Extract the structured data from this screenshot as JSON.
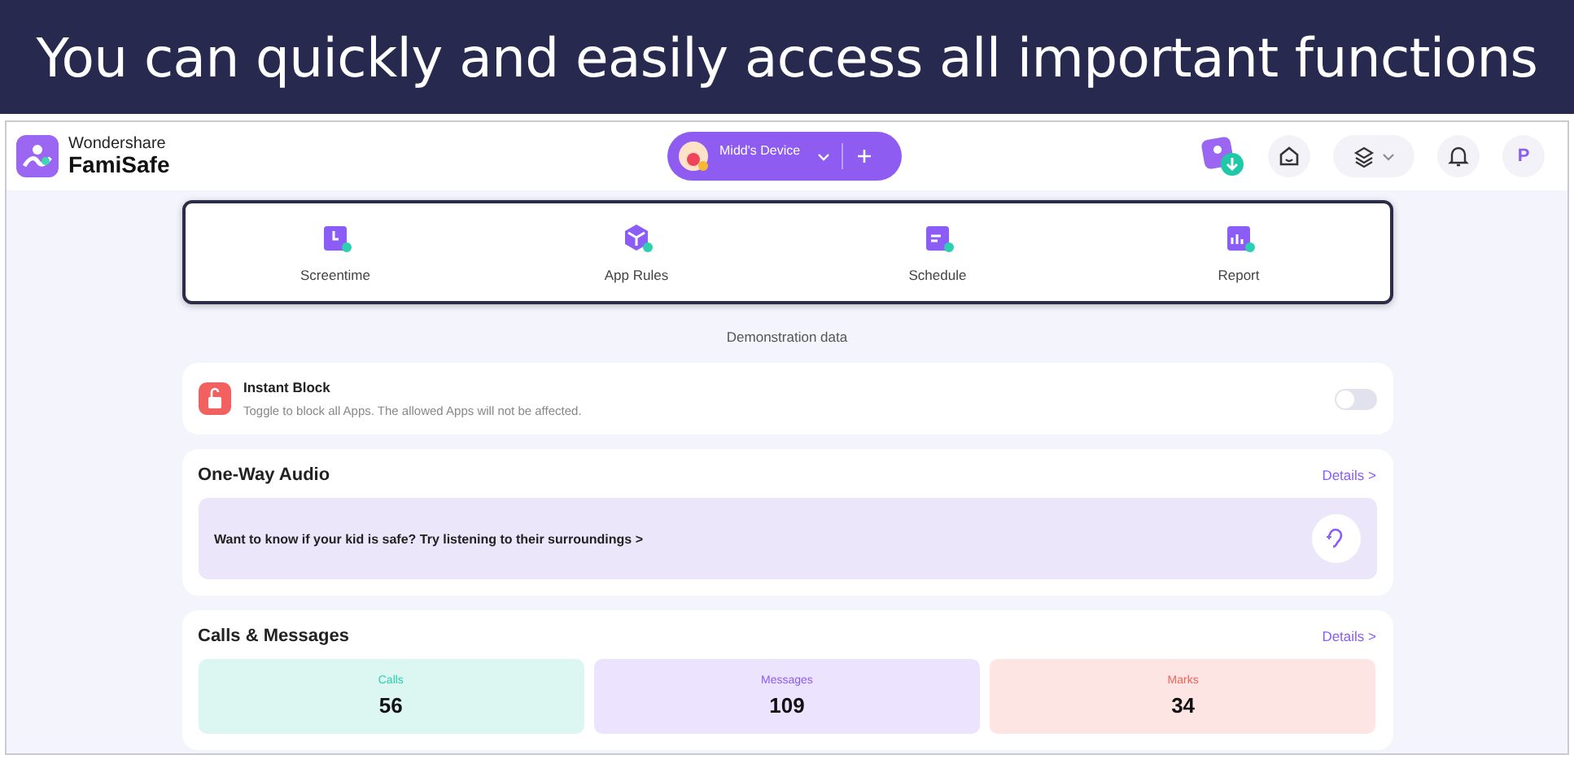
{
  "banner": {
    "text": "You can quickly and easily access all important functions"
  },
  "header": {
    "brand_top": "Wondershare",
    "brand_name": "FamiSafe",
    "device": {
      "name": "Midd's Device"
    },
    "avatar_letter": "P"
  },
  "features": [
    {
      "label": "Screentime",
      "kind": "clock"
    },
    {
      "label": "App Rules",
      "kind": "cube"
    },
    {
      "label": "Schedule",
      "kind": "calendar"
    },
    {
      "label": "Report",
      "kind": "chart"
    }
  ],
  "demo_note": "Demonstration data",
  "instant_block": {
    "title": "Instant Block",
    "description": "Toggle to block all Apps. The allowed Apps will not be affected.",
    "on": false
  },
  "one_way_audio": {
    "title": "One-Way Audio",
    "details": "Details >",
    "prompt": "Want to know if your kid is safe? Try listening to their surroundings >"
  },
  "calls_messages": {
    "title": "Calls & Messages",
    "details": "Details >",
    "stats": [
      {
        "label": "Calls",
        "value": "56",
        "color": "#2ccfb0"
      },
      {
        "label": "Messages",
        "value": "109",
        "color": "#8b5cf6"
      },
      {
        "label": "Marks",
        "value": "34",
        "color": "#f0645a"
      }
    ]
  }
}
